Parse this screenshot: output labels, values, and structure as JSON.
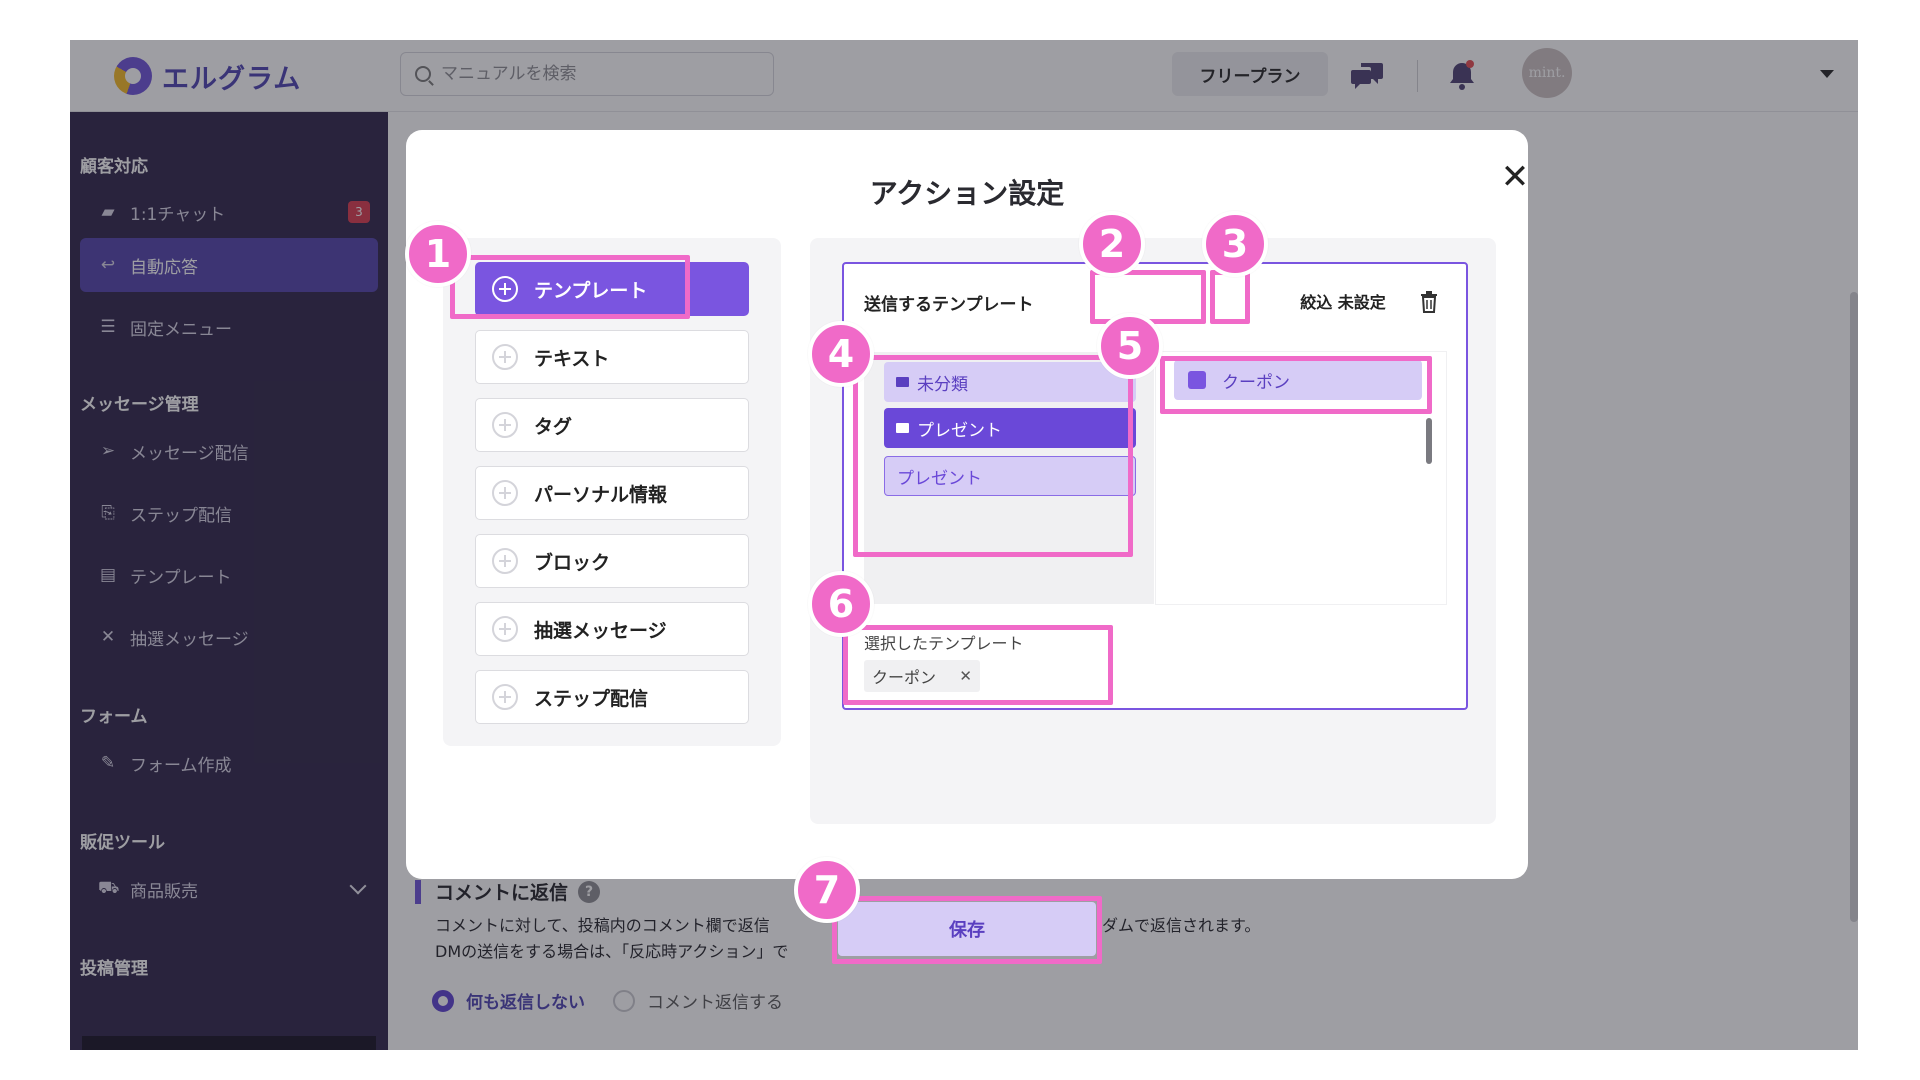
{
  "header": {
    "logo_text": "エルグラム",
    "search_placeholder": "マニュアルを検索",
    "plan_label": "フリープラン",
    "avatar_text": "mint."
  },
  "sidebar": {
    "section_support": "顧客対応",
    "item_chat": "1:1チャット",
    "chat_badge": "3",
    "item_auto_reply": "自動応答",
    "item_fixed_menu": "固定メニュー",
    "section_message": "メッセージ管理",
    "item_message_delivery": "メッセージ配信",
    "item_step_delivery": "ステップ配信",
    "item_template": "テンプレート",
    "item_lottery": "抽選メッセージ",
    "section_form": "フォーム",
    "item_form_create": "フォーム作成",
    "section_promo": "販促ツール",
    "item_product_sales": "商品販売",
    "section_post": "投稿管理",
    "collapse_icon": "≤"
  },
  "background": {
    "reply_title": "コメントに返信",
    "reply_help": "?",
    "desc_line1": "コメントに対して、投稿内のコメント欄で返信",
    "desc_line1_tail": "ダムで返信されます。",
    "desc_line2": "DMの送信をする場合は、「反応時アクション」で",
    "radio_no_reply": "何も返信しない",
    "radio_reply": "コメント返信する"
  },
  "modal": {
    "title": "アクション設定",
    "close": "✕",
    "actions": [
      {
        "label": "テンプレート"
      },
      {
        "label": "テキスト"
      },
      {
        "label": "タグ"
      },
      {
        "label": "パーソナル情報"
      },
      {
        "label": "ブロック"
      },
      {
        "label": "抽選メッセージ"
      },
      {
        "label": "ステップ配信"
      }
    ],
    "template_label": "送信するテンプレート",
    "filter_label": "絞込 未設定",
    "folders": [
      {
        "label": "未分類"
      },
      {
        "label": "プレゼント"
      },
      {
        "label": "プレゼント"
      }
    ],
    "templates": [
      {
        "label": "クーポン"
      }
    ],
    "selected_label": "選択したテンプレート",
    "selected_chip": "クーポン",
    "chip_remove": "✕",
    "save_label": "保存"
  },
  "annotations": [
    "1",
    "2",
    "3",
    "4",
    "5",
    "6",
    "7"
  ],
  "colors": {
    "accent": "#7a55e0",
    "sidebar_bg": "#2a2045",
    "highlight": "#f06ac8"
  }
}
